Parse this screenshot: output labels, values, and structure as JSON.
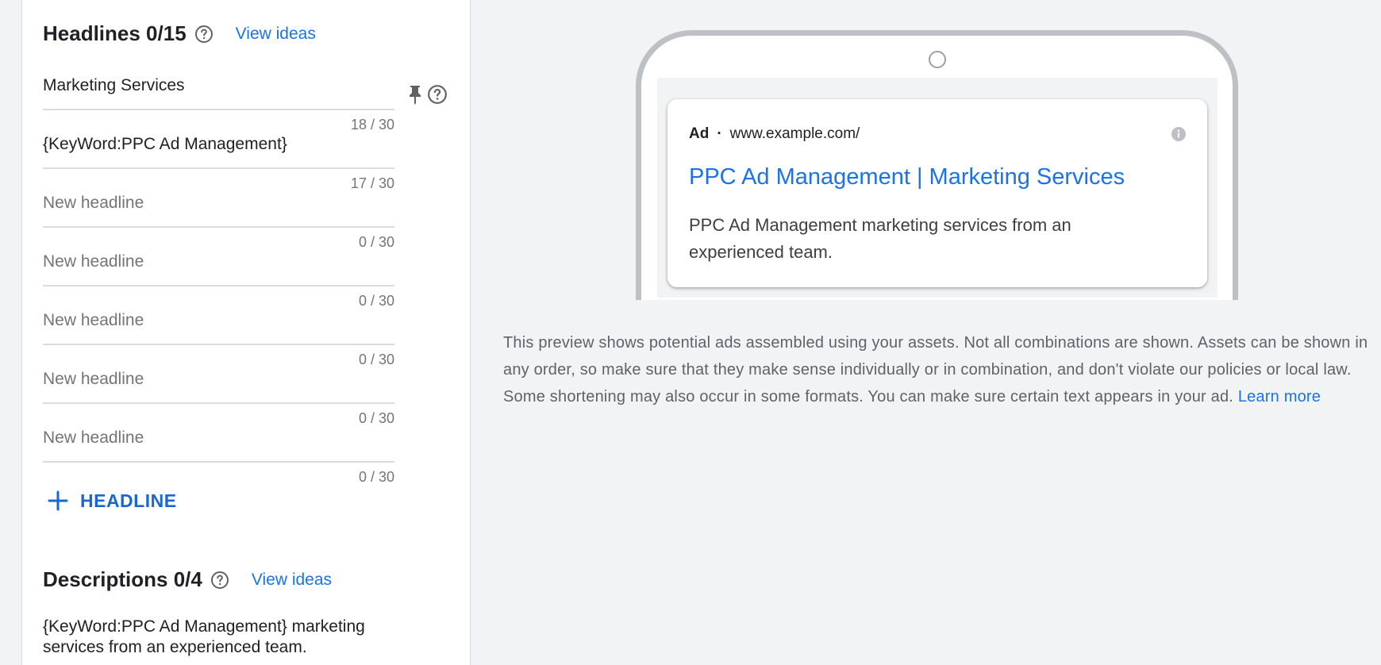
{
  "headlines": {
    "title": "Headlines 0/15",
    "view_ideas": "View ideas",
    "fields": [
      {
        "text": "Marketing Services",
        "count": "18 / 30",
        "placeholder": false
      },
      {
        "text": "{KeyWord:PPC Ad Management}",
        "count": "17 / 30",
        "placeholder": false
      },
      {
        "text": "New headline",
        "count": "0 / 30",
        "placeholder": true
      },
      {
        "text": "New headline",
        "count": "0 / 30",
        "placeholder": true
      },
      {
        "text": "New headline",
        "count": "0 / 30",
        "placeholder": true
      },
      {
        "text": "New headline",
        "count": "0 / 30",
        "placeholder": true
      },
      {
        "text": "New headline",
        "count": "0 / 30",
        "placeholder": true
      }
    ],
    "add_label": "HEADLINE"
  },
  "descriptions": {
    "title": "Descriptions 0/4",
    "view_ideas": "View ideas",
    "first_text": "{KeyWord:PPC Ad Management} marketing services from an experienced team."
  },
  "preview": {
    "ad_badge": "Ad",
    "dot": "·",
    "url": "www.example.com/",
    "headline": "PPC Ad Management | Marketing Services",
    "description": "PPC Ad Management marketing services from an experienced team."
  },
  "note": {
    "text": "This preview shows potential ads assembled using your assets. Not all combinations are shown. Assets can be shown in any order, so make sure that they make sense individually or in combination, and don't violate our policies or local law. Some shortening may also occur in some formats. You can make sure certain text appears in your ad.",
    "learn_more": "Learn more"
  },
  "icons": {
    "help": "help-circle-icon",
    "pin": "pin-icon",
    "add": "plus-icon",
    "info": "info-icon"
  },
  "colors": {
    "accent": "#1a73e8",
    "panel_bg": "#ffffff",
    "page_bg": "#f1f3f4"
  }
}
